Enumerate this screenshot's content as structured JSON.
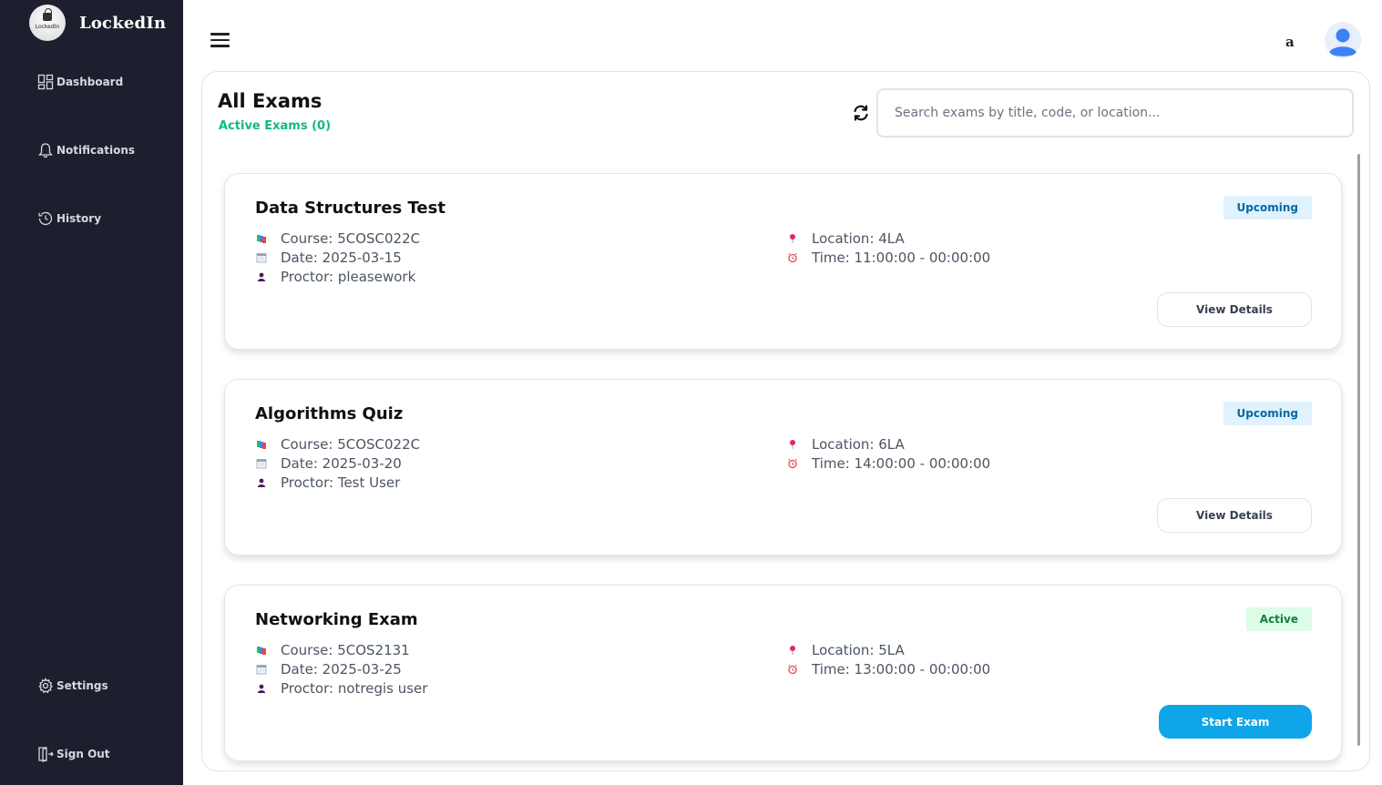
{
  "app": {
    "name": "LockedIn",
    "logo_text": "LockedIn"
  },
  "sidebar": {
    "items": [
      {
        "label": "Dashboard",
        "icon": "dashboard-icon"
      },
      {
        "label": "Notifications",
        "icon": "bell-icon"
      },
      {
        "label": "History",
        "icon": "history-icon"
      },
      {
        "label": "Settings",
        "icon": "gear-icon"
      },
      {
        "label": "Sign Out",
        "icon": "sign-out-icon"
      }
    ]
  },
  "header": {
    "user_initial": "a"
  },
  "main": {
    "title": "All Exams",
    "active_count_label": "Active Exams (0)",
    "search_placeholder": "Search exams by title, code, or location..."
  },
  "exams": [
    {
      "title": "Data Structures Test",
      "status": "Upcoming",
      "course": "Course: 5COSC022C",
      "date": "Date: 2025-03-15",
      "proctor": "Proctor: pleasework",
      "location": "Location: 4LA",
      "time": "Time: 11:00:00 - 00:00:00",
      "action": "View Details"
    },
    {
      "title": "Algorithms Quiz",
      "status": "Upcoming",
      "course": "Course: 5COSC022C",
      "date": "Date: 2025-03-20",
      "proctor": "Proctor: Test User",
      "location": "Location: 6LA",
      "time": "Time: 14:00:00 - 00:00:00",
      "action": "View Details"
    },
    {
      "title": "Networking Exam",
      "status": "Active",
      "course": "Course: 5COS2131",
      "date": "Date: 2025-03-25",
      "proctor": "Proctor: notregis user",
      "location": "Location: 5LA",
      "time": "Time: 13:00:00 - 00:00:00",
      "action": "Start Exam"
    }
  ],
  "colors": {
    "sidebar_bg": "#1e1f2e",
    "active_green": "#10b981",
    "primary_blue": "#0ea5e9",
    "upcoming_bg": "#e0f2fe",
    "active_bg": "#dcfce7"
  }
}
